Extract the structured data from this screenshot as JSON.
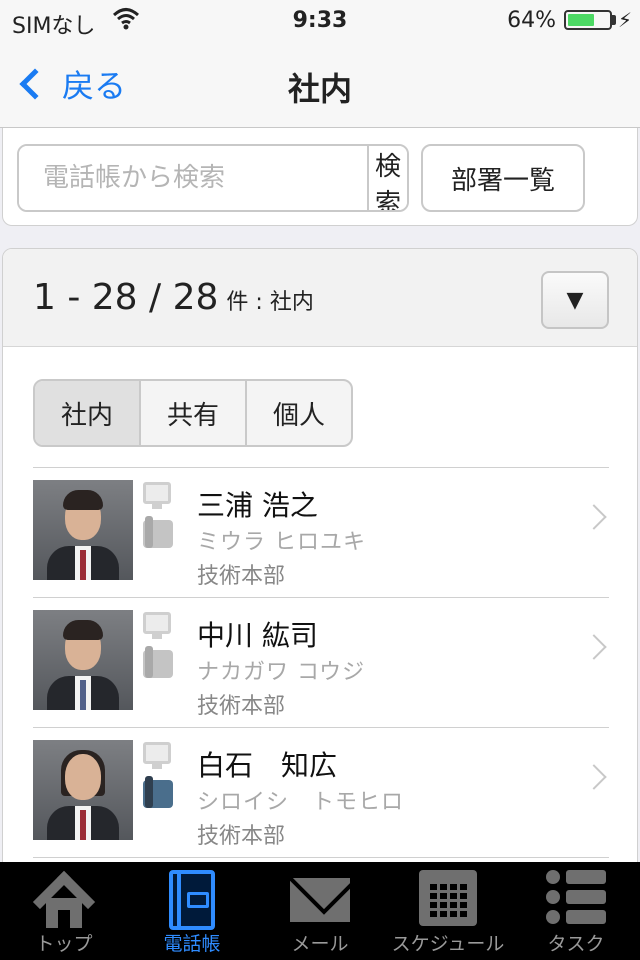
{
  "status_bar": {
    "carrier": "SIMなし",
    "time": "9:33",
    "battery_percent_text": "64%",
    "battery_level": 0.64,
    "colors": {
      "battery": "#4cd964"
    }
  },
  "nav": {
    "back_label": "戻る",
    "title": "社内",
    "accent": "#1a7bf2"
  },
  "search": {
    "placeholder": "電話帳から検索",
    "value": "",
    "button_label": "検索",
    "dept_button_label": "部署一覧"
  },
  "results": {
    "count_text": "1 - 28 / 28",
    "count_suffix": "件 : 社内",
    "dropdown_glyph": "▼"
  },
  "segments": [
    {
      "label": "社内",
      "active": true
    },
    {
      "label": "共有",
      "active": false
    },
    {
      "label": "個人",
      "active": false
    }
  ],
  "contacts": [
    {
      "name": "三浦 浩之",
      "kana": "ミウラ ヒロユキ",
      "dept": "技術本部",
      "phone_active": false
    },
    {
      "name": "中川 紘司",
      "kana": "ナカガワ コウジ",
      "dept": "技術本部",
      "phone_active": false
    },
    {
      "name": "白石　知広",
      "kana": "シロイシ　トモヒロ",
      "dept": "技術本部",
      "phone_active": true
    }
  ],
  "tabbar": {
    "active_color": "#2f8cff",
    "tabs": [
      {
        "label": "トップ",
        "icon": "home-icon",
        "active": false
      },
      {
        "label": "電話帳",
        "icon": "phonebook-icon",
        "active": true
      },
      {
        "label": "メール",
        "icon": "mail-icon",
        "active": false
      },
      {
        "label": "スケジュール",
        "icon": "calendar-icon",
        "active": false
      },
      {
        "label": "タスク",
        "icon": "task-list-icon",
        "active": false
      }
    ]
  }
}
